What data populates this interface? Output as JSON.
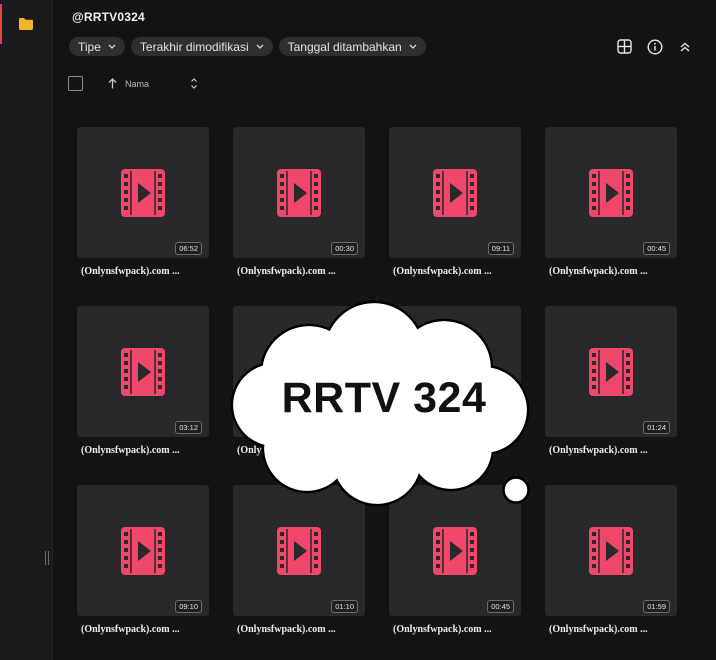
{
  "sidebar": {
    "items": [
      {
        "icon": "folder-icon",
        "active": true,
        "color": "#f5b324"
      }
    ]
  },
  "header": {
    "title": "@RRTV0324"
  },
  "filters": [
    {
      "label": "Tipe"
    },
    {
      "label": "Terakhir dimodifikasi"
    },
    {
      "label": "Tanggal ditambahkan"
    }
  ],
  "toolbar": {
    "icons": [
      "grid-view-icon",
      "info-icon",
      "collapse-icon"
    ]
  },
  "sort": {
    "label": "Nama",
    "direction": "ascending"
  },
  "files": [
    {
      "name": "(Onlynsfwpack).com ...",
      "duration": "06:52"
    },
    {
      "name": "(Onlynsfwpack).com ...",
      "duration": "00:30"
    },
    {
      "name": "(Onlynsfwpack).com ...",
      "duration": "09:11"
    },
    {
      "name": "(Onlynsfwpack).com ...",
      "duration": "00:45"
    },
    {
      "name": "(Onlynsfwpack).com ...",
      "duration": "03:12"
    },
    {
      "name": "(Onlynsfwpack).com ...",
      "duration": ""
    },
    {
      "name": "",
      "duration": ""
    },
    {
      "name": "(Onlynsfwpack).com ...",
      "duration": "01:24"
    },
    {
      "name": "(Onlynsfwpack).com ...",
      "duration": "09:10"
    },
    {
      "name": "(Onlynsfwpack).com ...",
      "duration": "01:10"
    },
    {
      "name": "(Onlynsfwpack).com ...",
      "duration": "00:45"
    },
    {
      "name": "(Onlynsfwpack).com ...",
      "duration": "01:59"
    }
  ],
  "overlay": {
    "text": "RRTV 324"
  },
  "colors": {
    "accent": "#e0463c",
    "video_icon": "#f0476b",
    "folder": "#f5b324"
  }
}
